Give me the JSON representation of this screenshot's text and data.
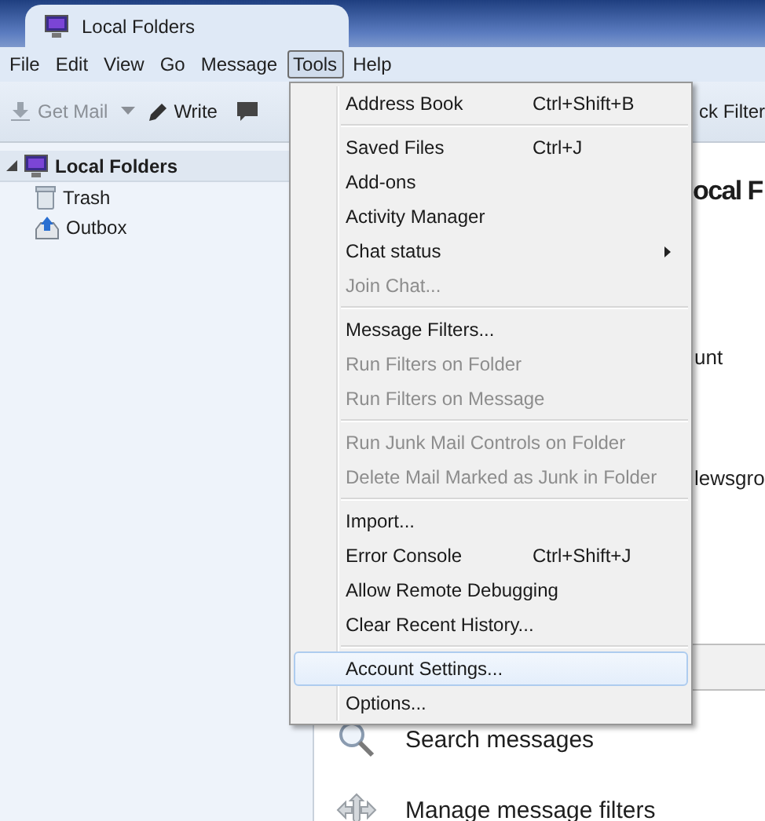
{
  "window": {
    "tab_title": "Local Folders"
  },
  "menubar": [
    {
      "label": "File",
      "selected": false
    },
    {
      "label": "Edit",
      "selected": false
    },
    {
      "label": "View",
      "selected": false
    },
    {
      "label": "Go",
      "selected": false
    },
    {
      "label": "Message",
      "selected": false
    },
    {
      "label": "Tools",
      "selected": true
    },
    {
      "label": "Help",
      "selected": false
    }
  ],
  "toolbar": {
    "get_mail": {
      "label": "Get Mail",
      "disabled": true
    },
    "write": {
      "label": "Write"
    },
    "quick_filter": "ck Filter"
  },
  "folders": [
    {
      "label": "Local Folders",
      "expanded": true,
      "selected": true,
      "children": [
        {
          "label": "Trash",
          "kind": "trash"
        },
        {
          "label": "Outbox",
          "kind": "outbox"
        }
      ]
    }
  ],
  "content": {
    "heading": "ocal F",
    "line_1": "unt",
    "line_2": "lewsgro",
    "actions": [
      {
        "label": "Search messages",
        "kind": "search"
      },
      {
        "label": "Manage message filters",
        "kind": "filters"
      }
    ]
  },
  "tools_menu": [
    {
      "kind": "item",
      "label": "Address Book",
      "shortcut": "Ctrl+Shift+B",
      "disabled": false,
      "selected": false,
      "has_submenu": false
    },
    {
      "kind": "separator"
    },
    {
      "kind": "item",
      "label": "Saved Files",
      "shortcut": "Ctrl+J",
      "disabled": false,
      "selected": false,
      "has_submenu": false
    },
    {
      "kind": "item",
      "label": "Add-ons",
      "disabled": false,
      "selected": false,
      "has_submenu": false
    },
    {
      "kind": "item",
      "label": "Activity Manager",
      "disabled": false,
      "selected": false,
      "has_submenu": false
    },
    {
      "kind": "item",
      "label": "Chat status",
      "disabled": false,
      "selected": false,
      "has_submenu": true
    },
    {
      "kind": "item",
      "label": "Join Chat...",
      "disabled": true,
      "selected": false,
      "has_submenu": false
    },
    {
      "kind": "separator"
    },
    {
      "kind": "item",
      "label": "Message Filters...",
      "disabled": false,
      "selected": false,
      "has_submenu": false
    },
    {
      "kind": "item",
      "label": "Run Filters on Folder",
      "disabled": true,
      "selected": false,
      "has_submenu": false
    },
    {
      "kind": "item",
      "label": "Run Filters on Message",
      "disabled": true,
      "selected": false,
      "has_submenu": false
    },
    {
      "kind": "separator"
    },
    {
      "kind": "item",
      "label": "Run Junk Mail Controls on Folder",
      "disabled": true,
      "selected": false,
      "has_submenu": false
    },
    {
      "kind": "item",
      "label": "Delete Mail Marked as Junk in Folder",
      "disabled": true,
      "selected": false,
      "has_submenu": false
    },
    {
      "kind": "separator"
    },
    {
      "kind": "item",
      "label": "Import...",
      "disabled": false,
      "selected": false,
      "has_submenu": false
    },
    {
      "kind": "item",
      "label": "Error Console",
      "shortcut": "Ctrl+Shift+J",
      "disabled": false,
      "selected": false,
      "has_submenu": false
    },
    {
      "kind": "item",
      "label": "Allow Remote Debugging",
      "disabled": false,
      "selected": false,
      "has_submenu": false
    },
    {
      "kind": "item",
      "label": "Clear Recent History...",
      "disabled": false,
      "selected": false,
      "has_submenu": false
    },
    {
      "kind": "separator"
    },
    {
      "kind": "item",
      "label": "Account Settings...",
      "disabled": false,
      "selected": true,
      "has_submenu": false
    },
    {
      "kind": "item",
      "label": "Options...",
      "disabled": false,
      "selected": false,
      "has_submenu": false
    }
  ]
}
